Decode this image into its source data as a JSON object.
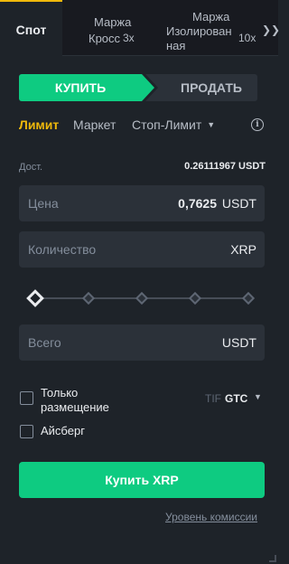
{
  "tabs": {
    "spot": "Спот",
    "cross_line1": "Маржа",
    "cross_line2": "Кросс",
    "cross_leverage": "3x",
    "isolated_line1": "Маржа",
    "isolated_line2": "Изолирован",
    "isolated_line3": "ная",
    "isolated_leverage": "10x",
    "more": "❯❯"
  },
  "side": {
    "buy": "КУПИТЬ",
    "sell": "ПРОДАТЬ",
    "buy_color": "#0ecb81"
  },
  "order_types": {
    "limit": "Лимит",
    "market": "Маркет",
    "stop_limit": "Стоп-Лимит",
    "active": "limit",
    "info_icon": "i"
  },
  "available": {
    "label": "Дост.",
    "value": "0.26111967 USDT"
  },
  "price": {
    "label": "Цена",
    "value": "0,7625",
    "unit": "USDT"
  },
  "quantity": {
    "label": "Количество",
    "value": "",
    "unit": "XRP"
  },
  "slider": {
    "percent": 0,
    "stops": [
      0,
      25,
      50,
      75,
      100
    ]
  },
  "total": {
    "label": "Всего",
    "unit": "USDT"
  },
  "options": {
    "post_only_line1": "Только",
    "post_only_line2": "размещение",
    "iceberg": "Айсберг",
    "tif_label": "TIF",
    "tif_value": "GTC"
  },
  "submit": {
    "label": "Купить XRP"
  },
  "fee_link": "Уровень комиссии",
  "colors": {
    "accent": "#f0b90b",
    "buy": "#0ecb81",
    "panel": "#1e2329",
    "input": "#2b3139"
  }
}
